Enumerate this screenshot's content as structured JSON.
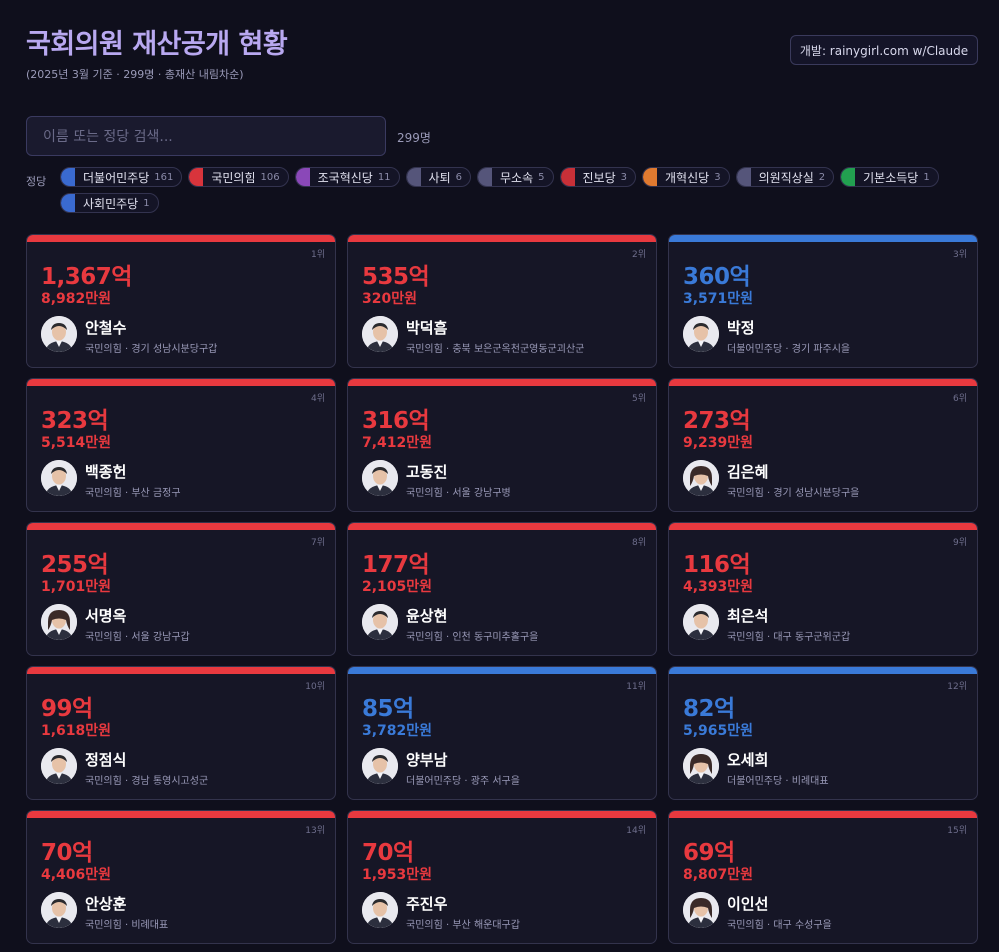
{
  "header": {
    "title": "국회의원 재산공개 현황",
    "subtitle": "(2025년 3월 기준 · 299명 · 총재산 내림차순)",
    "dev_badge": "개발: rainygirl.com w/Claude"
  },
  "search": {
    "placeholder": "이름 또는 정당 검색...",
    "count": "299명"
  },
  "filter": {
    "label": "정당",
    "parties": [
      {
        "name": "더불어민주당",
        "count": "161",
        "color": "#3a6ad0"
      },
      {
        "name": "국민의힘",
        "count": "106",
        "color": "#d8343c"
      },
      {
        "name": "조국혁신당",
        "count": "11",
        "color": "#8a48b8"
      },
      {
        "name": "사퇴",
        "count": "6",
        "color": "#55557a"
      },
      {
        "name": "무소속",
        "count": "5",
        "color": "#55557a"
      },
      {
        "name": "진보당",
        "count": "3",
        "color": "#c83038"
      },
      {
        "name": "개혁신당",
        "count": "3",
        "color": "#e07a30"
      },
      {
        "name": "의원직상실",
        "count": "2",
        "color": "#55557a"
      },
      {
        "name": "기본소득당",
        "count": "1",
        "color": "#22a050"
      },
      {
        "name": "사회민주당",
        "count": "1",
        "color": "#3a6ad0"
      }
    ]
  },
  "colors": {
    "red": "#e8393f",
    "blue": "#3a7ad8"
  },
  "members": [
    {
      "rank": "1위",
      "eok": "1,367억",
      "man": "8,982만원",
      "name": "안철수",
      "party": "국민의힘",
      "region": "경기 성남시분당구갑",
      "color": "red",
      "avatar": "avatar-photo"
    },
    {
      "rank": "2위",
      "eok": "535억",
      "man": "320만원",
      "name": "박덕흠",
      "party": "국민의힘",
      "region": "충북 보은군옥천군영동군괴산군",
      "color": "red",
      "avatar": "avatar-photo"
    },
    {
      "rank": "3위",
      "eok": "360억",
      "man": "3,571만원",
      "name": "박정",
      "party": "더불어민주당",
      "region": "경기 파주시을",
      "color": "blue",
      "avatar": "avatar-photo"
    },
    {
      "rank": "4위",
      "eok": "323억",
      "man": "5,514만원",
      "name": "백종헌",
      "party": "국민의힘",
      "region": "부산 금정구",
      "color": "red",
      "avatar": "avatar-photo"
    },
    {
      "rank": "5위",
      "eok": "316억",
      "man": "7,412만원",
      "name": "고동진",
      "party": "국민의힘",
      "region": "서울 강남구병",
      "color": "red",
      "avatar": "avatar-photo"
    },
    {
      "rank": "6위",
      "eok": "273억",
      "man": "9,239만원",
      "name": "김은혜",
      "party": "국민의힘",
      "region": "경기 성남시분당구을",
      "color": "red",
      "avatar": "avatar-photo"
    },
    {
      "rank": "7위",
      "eok": "255억",
      "man": "1,701만원",
      "name": "서명옥",
      "party": "국민의힘",
      "region": "서울 강남구갑",
      "color": "red",
      "avatar": "avatar-photo"
    },
    {
      "rank": "8위",
      "eok": "177억",
      "man": "2,105만원",
      "name": "윤상현",
      "party": "국민의힘",
      "region": "인천 동구미추홀구을",
      "color": "red",
      "avatar": "avatar-photo"
    },
    {
      "rank": "9위",
      "eok": "116억",
      "man": "4,393만원",
      "name": "최은석",
      "party": "국민의힘",
      "region": "대구 동구군위군갑",
      "color": "red",
      "avatar": "avatar-photo"
    },
    {
      "rank": "10위",
      "eok": "99억",
      "man": "1,618만원",
      "name": "정점식",
      "party": "국민의힘",
      "region": "경남 통영시고성군",
      "color": "red",
      "avatar": "avatar-photo"
    },
    {
      "rank": "11위",
      "eok": "85억",
      "man": "3,782만원",
      "name": "양부남",
      "party": "더불어민주당",
      "region": "광주 서구을",
      "color": "blue",
      "avatar": "avatar-photo"
    },
    {
      "rank": "12위",
      "eok": "82억",
      "man": "5,965만원",
      "name": "오세희",
      "party": "더불어민주당",
      "region": "비례대표",
      "color": "blue",
      "avatar": "avatar-photo"
    },
    {
      "rank": "13위",
      "eok": "70억",
      "man": "4,406만원",
      "name": "안상훈",
      "party": "국민의힘",
      "region": "비례대표",
      "color": "red",
      "avatar": "avatar-photo"
    },
    {
      "rank": "14위",
      "eok": "70억",
      "man": "1,953만원",
      "name": "주진우",
      "party": "국민의힘",
      "region": "부산 해운대구갑",
      "color": "red",
      "avatar": "avatar-photo"
    },
    {
      "rank": "15위",
      "eok": "69억",
      "man": "8,807만원",
      "name": "이인선",
      "party": "국민의힘",
      "region": "대구 수성구을",
      "color": "red",
      "avatar": "avatar-photo"
    }
  ]
}
